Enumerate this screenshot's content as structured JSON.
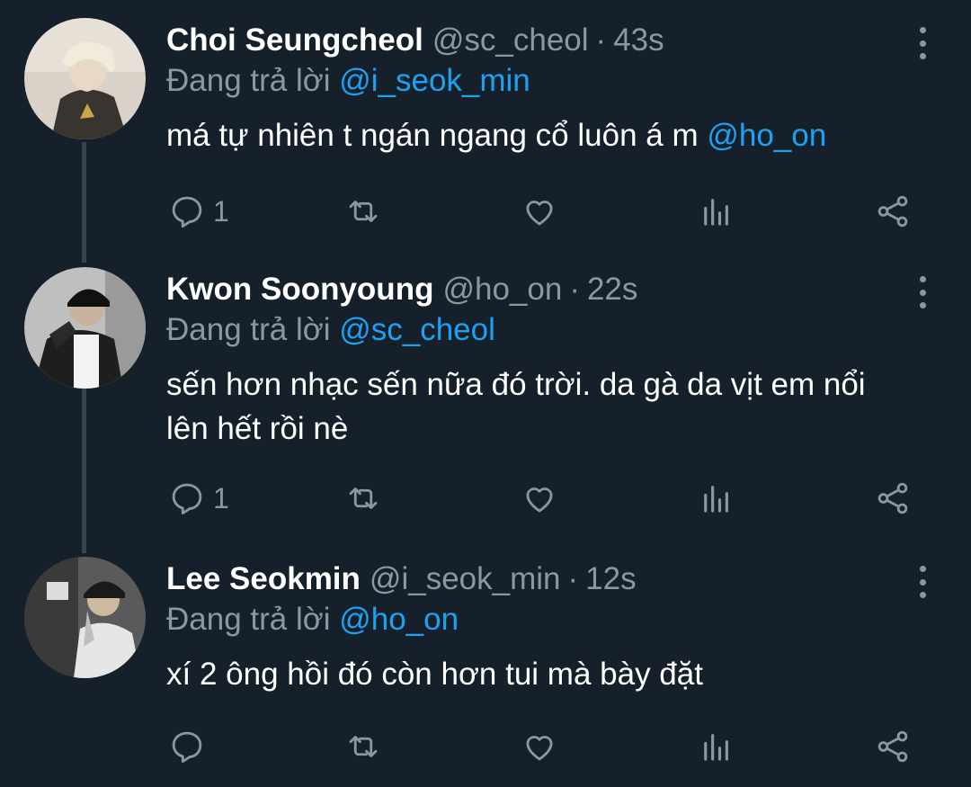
{
  "replying_prefix": "Đang trả lời",
  "tweets": [
    {
      "name": "Choi Seungcheol",
      "handle": "@sc_cheol",
      "time": "43s",
      "reply_to": "@i_seok_min",
      "text": "má tự nhiên t ngán ngang cổ luôn á m",
      "mention": "@ho_on",
      "reply_count": "1"
    },
    {
      "name": "Kwon Soonyoung",
      "handle": "@ho_on",
      "time": "22s",
      "reply_to": "@sc_cheol",
      "text": "sến hơn nhạc sến nữa đó trời. da gà da vịt em nổi lên hết rồi nè",
      "mention": "",
      "reply_count": "1"
    },
    {
      "name": "Lee Seokmin",
      "handle": "@i_seok_min",
      "time": "12s",
      "reply_to": "@ho_on",
      "text": "xí 2 ông hồi đó còn hơn tui mà bày đặt",
      "mention": "",
      "reply_count": ""
    }
  ],
  "colors": {
    "background": "#15202b",
    "text": "#ffffff",
    "muted": "#8899a6",
    "link": "#1da1f2",
    "thread_line": "#38444d"
  },
  "icons": [
    "reply-icon",
    "retweet-icon",
    "like-icon",
    "analytics-icon",
    "share-icon",
    "more-icon"
  ]
}
